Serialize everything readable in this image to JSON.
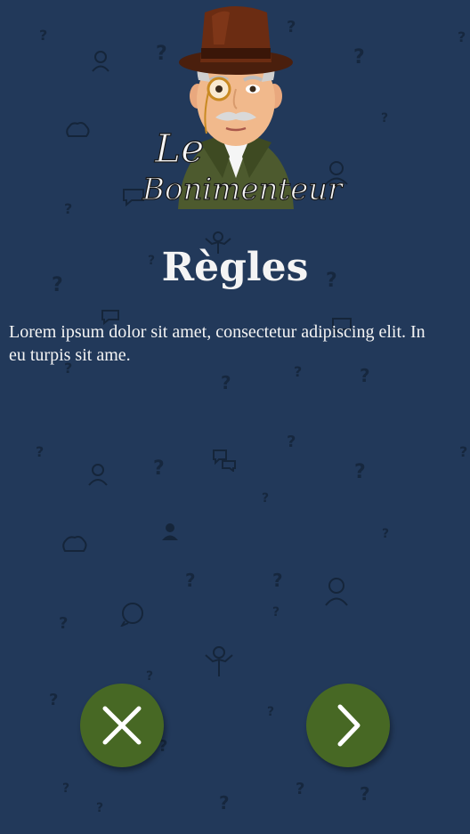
{
  "logo": {
    "line1": "Le",
    "line2": "Bonimenteur"
  },
  "page": {
    "title": "Règles",
    "rules_text": "Lorem ipsum dolor sit amet, consectetur adipiscing elit. In eu turpis sit ame."
  },
  "buttons": {
    "refuse_icon": "close-icon",
    "next_icon": "chevron-right-icon"
  },
  "colors": {
    "background": "#22395a",
    "pattern": "#15253a",
    "button": "#476824",
    "text": "#f4f4f4"
  }
}
